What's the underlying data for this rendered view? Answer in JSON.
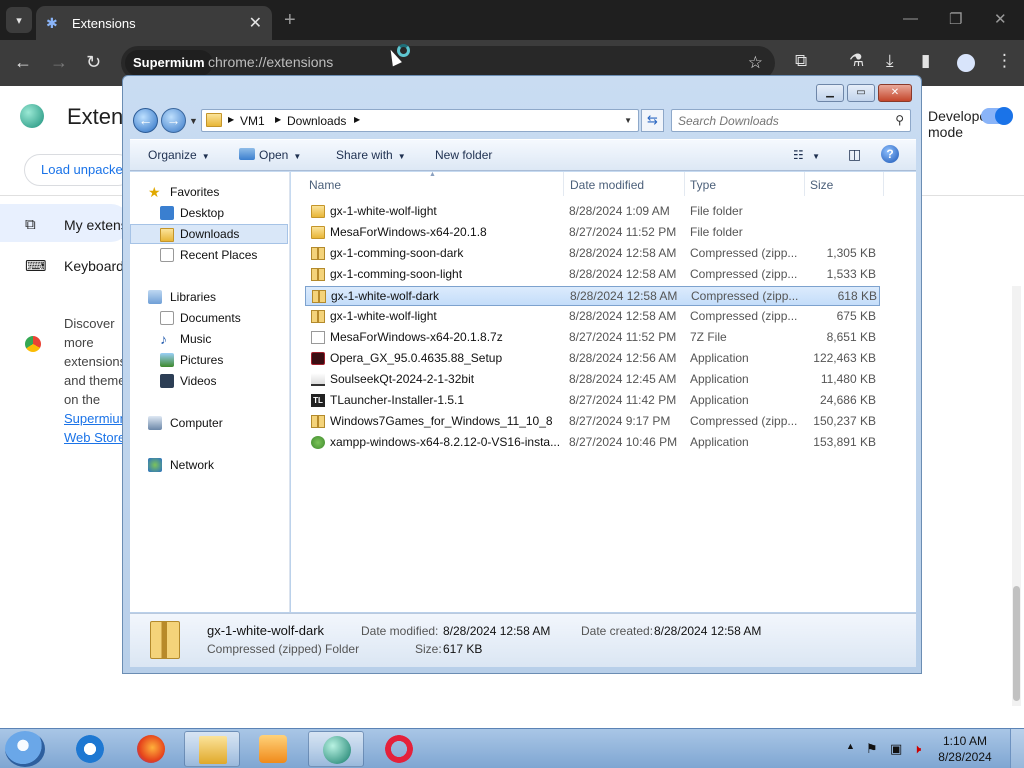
{
  "chrome": {
    "tab_title": "Extensions",
    "omnibox_chip": "Supermium",
    "url": "chrome://extensions",
    "page_title": "Extensions",
    "dev_mode_label": "Developer mode",
    "load_unpacked": "Load unpacked",
    "nav_my_extensions": "My extensions",
    "nav_keyboard": "Keyboard shortcuts",
    "discover_text": "Discover more extensions and themes on the",
    "discover_link": "Supermium Web Store",
    "colors": {
      "tabbar": "#1f1f1f",
      "toolbar": "#3c3c3c",
      "accent": "#1a73e8"
    }
  },
  "explorer": {
    "breadcrumb": [
      "VM1",
      "Downloads"
    ],
    "search_placeholder": "Search Downloads",
    "commands": {
      "organize": "Organize",
      "open": "Open",
      "share_with": "Share with",
      "new_folder": "New folder"
    },
    "nav": {
      "favorites": "Favorites",
      "desktop": "Desktop",
      "downloads": "Downloads",
      "recent_places": "Recent Places",
      "libraries": "Libraries",
      "documents": "Documents",
      "music": "Music",
      "pictures": "Pictures",
      "videos": "Videos",
      "computer": "Computer",
      "network": "Network"
    },
    "columns": {
      "name": "Name",
      "date": "Date modified",
      "type": "Type",
      "size": "Size"
    },
    "files": [
      {
        "name": "gx-1-white-wolf-light",
        "date": "8/28/2024 1:09 AM",
        "type": "File folder",
        "size": "",
        "icon": "folder-icon"
      },
      {
        "name": "MesaForWindows-x64-20.1.8",
        "date": "8/27/2024 11:52 PM",
        "type": "File folder",
        "size": "",
        "icon": "folder-icon"
      },
      {
        "name": "gx-1-comming-soon-dark",
        "date": "8/28/2024 12:58 AM",
        "type": "Compressed (zipp...",
        "size": "1,305 KB",
        "icon": "zip-folder-icon"
      },
      {
        "name": "gx-1-comming-soon-light",
        "date": "8/28/2024 12:58 AM",
        "type": "Compressed (zipp...",
        "size": "1,533 KB",
        "icon": "zip-folder-icon"
      },
      {
        "name": "gx-1-white-wolf-dark",
        "date": "8/28/2024 12:58 AM",
        "type": "Compressed (zipp...",
        "size": "618 KB",
        "icon": "zip-folder-icon"
      },
      {
        "name": "gx-1-white-wolf-light",
        "date": "8/28/2024 12:58 AM",
        "type": "Compressed (zipp...",
        "size": "675 KB",
        "icon": "zip-folder-icon"
      },
      {
        "name": "MesaForWindows-x64-20.1.8.7z",
        "date": "8/27/2024 11:52 PM",
        "type": "7Z File",
        "size": "8,651 KB",
        "icon": "file-icon"
      },
      {
        "name": "Opera_GX_95.0.4635.88_Setup",
        "date": "8/28/2024 12:56 AM",
        "type": "Application",
        "size": "122,463 KB",
        "icon": "opera-gx-icon"
      },
      {
        "name": "SoulseekQt-2024-2-1-32bit",
        "date": "8/28/2024 12:45 AM",
        "type": "Application",
        "size": "11,480 KB",
        "icon": "installer-icon"
      },
      {
        "name": "TLauncher-Installer-1.5.1",
        "date": "8/27/2024 11:42 PM",
        "type": "Application",
        "size": "24,686 KB",
        "icon": "tlauncher-icon"
      },
      {
        "name": "Windows7Games_for_Windows_11_10_8",
        "date": "8/27/2024 9:17 PM",
        "type": "Compressed (zipp...",
        "size": "150,237 KB",
        "icon": "zip-folder-icon"
      },
      {
        "name": "xampp-windows-x64-8.2.12-0-VS16-insta...",
        "date": "8/27/2024 10:46 PM",
        "type": "Application",
        "size": "153,891 KB",
        "icon": "xampp-icon"
      }
    ],
    "selected_index": 4,
    "details": {
      "name": "gx-1-white-wolf-dark",
      "type": "Compressed (zipped) Folder",
      "date_modified_label": "Date modified:",
      "date_modified": "8/28/2024 12:58 AM",
      "date_created_label": "Date created:",
      "date_created": "8/28/2024 12:58 AM",
      "size_label": "Size:",
      "size": "617 KB"
    }
  },
  "taskbar": {
    "time": "1:10 AM",
    "date": "8/28/2024",
    "apps": [
      "internet-explorer-icon",
      "firefox-icon",
      "file-explorer-icon",
      "media-player-icon",
      "supermium-icon",
      "opera-icon"
    ]
  }
}
